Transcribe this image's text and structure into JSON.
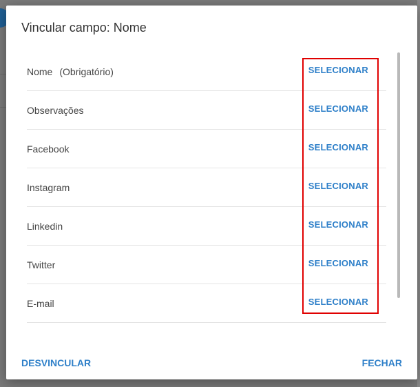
{
  "dialog": {
    "title": "Vincular campo: Nome",
    "fields": [
      {
        "label": "Nome",
        "note": "(Obrigatório)",
        "action": "SELECIONAR"
      },
      {
        "label": "Observações",
        "note": "",
        "action": "SELECIONAR"
      },
      {
        "label": "Facebook",
        "note": "",
        "action": "SELECIONAR"
      },
      {
        "label": "Instagram",
        "note": "",
        "action": "SELECIONAR"
      },
      {
        "label": "Linkedin",
        "note": "",
        "action": "SELECIONAR"
      },
      {
        "label": "Twitter",
        "note": "",
        "action": "SELECIONAR"
      },
      {
        "label": "E-mail",
        "note": "",
        "action": "SELECIONAR"
      }
    ],
    "unlink_label": "DESVINCULAR",
    "close_label": "FECHAR"
  },
  "colors": {
    "accent": "#2f80c9",
    "highlight": "#e00000",
    "overlay": "#7a7a7a"
  }
}
